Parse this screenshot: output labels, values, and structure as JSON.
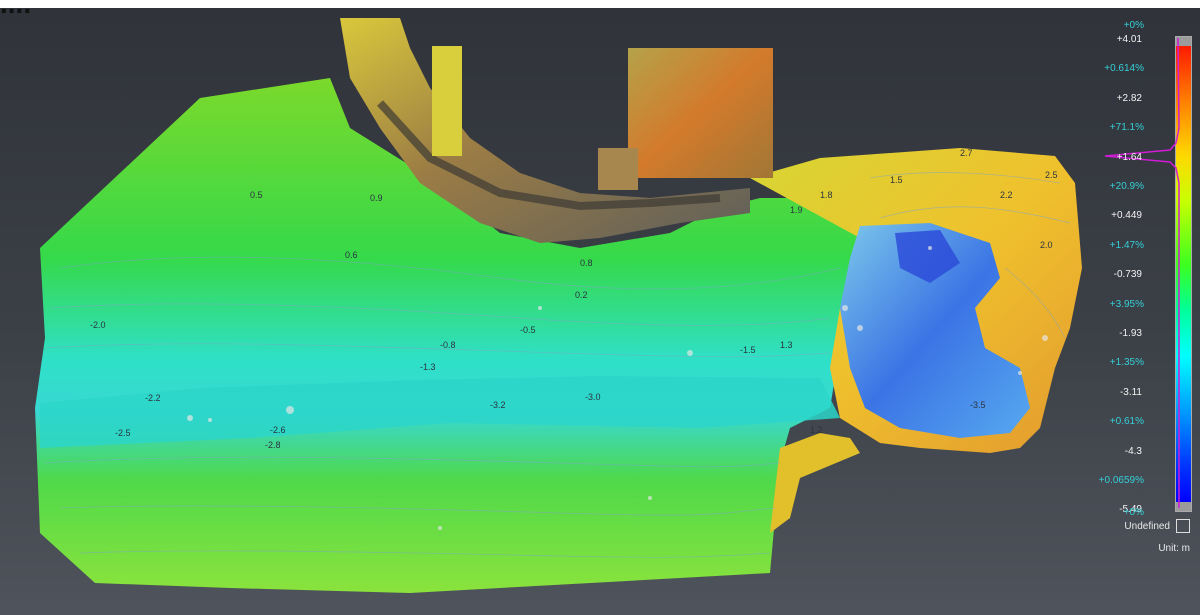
{
  "app": {
    "header_fragment": "...."
  },
  "scalebar": {
    "top_pct": "+0%",
    "bottom_pct": "+0%",
    "ticks": [
      {
        "value": "+4.01",
        "pct": ""
      },
      {
        "value": "",
        "pct": "+0.614%"
      },
      {
        "value": "+2.82",
        "pct": ""
      },
      {
        "value": "",
        "pct": "+71.1%"
      },
      {
        "value": "+1.64",
        "pct": ""
      },
      {
        "value": "",
        "pct": "+20.9%"
      },
      {
        "value": "+0.449",
        "pct": ""
      },
      {
        "value": "",
        "pct": "+1.47%"
      },
      {
        "value": "-0.739",
        "pct": ""
      },
      {
        "value": "",
        "pct": "+3.95%"
      },
      {
        "value": "-1.93",
        "pct": ""
      },
      {
        "value": "",
        "pct": "+1.35%"
      },
      {
        "value": "-3.11",
        "pct": ""
      },
      {
        "value": "",
        "pct": "+0.61%"
      },
      {
        "value": "-4.3",
        "pct": ""
      },
      {
        "value": "",
        "pct": "+0.0659%"
      },
      {
        "value": "-5.49",
        "pct": ""
      }
    ],
    "undefined_label": "Undefined",
    "unit_label": "Unit: m",
    "histogram_color": "#d01cd6",
    "colors": {
      "max": "#ff1a00",
      "mid": "#3cff20",
      "min": "#0000ff"
    }
  },
  "contour_labels": [
    "2.7",
    "2.5",
    "2.2",
    "2.0",
    "1.9",
    "1.8",
    "1.5",
    "1.3",
    "1.2",
    "0.9",
    "0.8",
    "0.6",
    "0.5",
    "0.2",
    "-0.5",
    "-0.8",
    "-1.3",
    "-1.5",
    "-2.2",
    "-2.5",
    "-2.8",
    "-3.0",
    "-3.2",
    "-3.5",
    "-2.6",
    "-2.0"
  ]
}
